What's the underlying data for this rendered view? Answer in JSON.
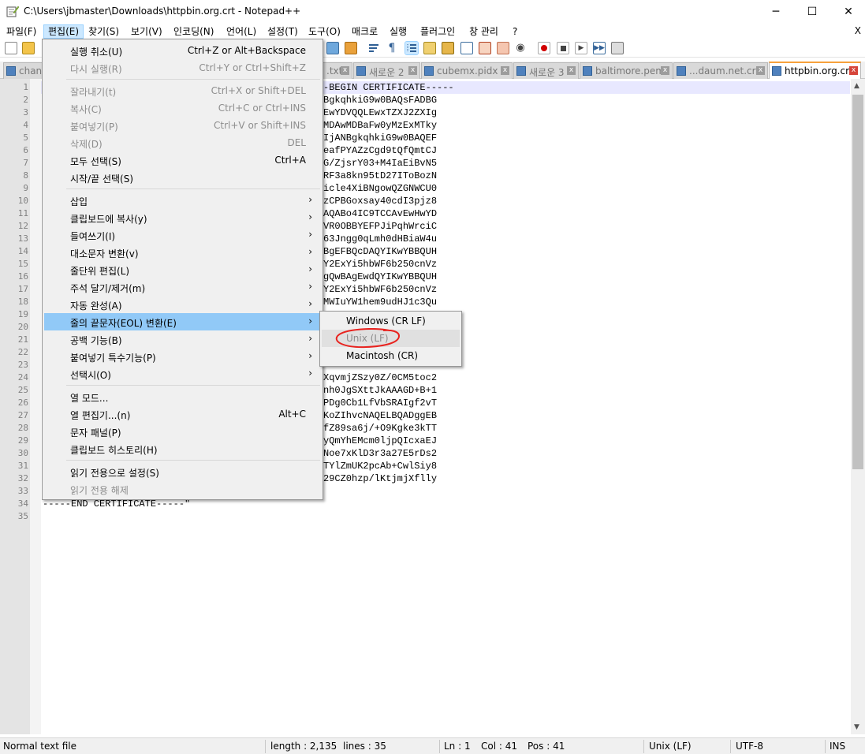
{
  "window": {
    "title": "C:\\Users\\jbmaster\\Downloads\\httpbin.org.crt - Notepad++",
    "minimize": "─",
    "maximize": "☐",
    "close": "✕"
  },
  "menubar": {
    "items": [
      "파일(F)",
      "편집(E)",
      "찾기(S)",
      "보기(V)",
      "인코딩(N)",
      "언어(L)",
      "설정(T)",
      "도구(O)",
      "매크로",
      "실행",
      "플러그인",
      "창 관리",
      "?"
    ],
    "close": "X",
    "active_index": 1
  },
  "tabs": [
    {
      "label": "chan",
      "active": false
    },
    {
      "label": ".txt",
      "active": false
    },
    {
      "label": "새로운 2",
      "active": false
    },
    {
      "label": "cubemx.pidx",
      "active": false
    },
    {
      "label": "새로운 3",
      "active": false
    },
    {
      "label": "baltimore.pem",
      "active": false
    },
    {
      "label": "...daum.net.crt",
      "active": false
    },
    {
      "label": "httpbin.org.crt",
      "active": true
    }
  ],
  "editor": {
    "line_numbers": [
      "1",
      "2",
      "3",
      "4",
      "5",
      "6",
      "7",
      "8",
      "9",
      "10",
      "11",
      "12",
      "13",
      "14",
      "15",
      "16",
      "17",
      "18",
      "19",
      "20",
      "21",
      "22",
      "23",
      "24",
      "25",
      "26",
      "27",
      "28",
      "29",
      "30",
      "31",
      "32",
      "33",
      "34",
      "35"
    ],
    "visible_code": [
      "-BEGIN CERTIFICATE-----",
      "BgkqhkiG9w0BAQsFADBG",
      "EwYDVQQLEwxTZXJ2ZXIg",
      "MDAwMDBaFw0yMzExMTky",
      "IjANBgkqhkiG9w0BAQEF",
      "eafPYAZzCgd9tQfQmtCJ",
      "G/ZjsrY03+M4IaEiBvN5",
      "RF3a8kn95tD27IToBozN",
      "iclе4XiBNgowQZGNWCU0",
      "zCPBGoxsay40cdI3pjz8",
      "AQABo4IC9TCCAvEwHwYD",
      "VR0OBBYEFPJiPqhWrciC",
      "63Jngg0qLmh0dHBiaW4u",
      "BgEFBQcDAQYIKwYBBQUH",
      "Y2ExYi5hbWF6b250cnVz",
      "gQwBAgEwdQYIKwYBBQUH",
      "Y2ExYi5hbWF6b250cnVz",
      "MWIuYW1hem9udHJ1c3Qu",
      "",
      "",
      "",
      "",
      "",
      "XqvmjZSzy0Z/0CM5toc2",
      "nh0JgSXttJkAAAGD+B+1",
      "PDg0Cb1LfVbSRAIgf2vT",
      "KoZIhvcNAQELBQADggEB",
      "fZ89sa6j/+O9Kgke3kTT",
      "yQmYhEMcm0ljpQIcxaEJ",
      "Noe7xKlD3r3a27E5rDs2",
      "TYlZmUK2pcAb+CwlSiy8",
      "29CZ0hzp/lKtjmjXflly",
      "",
      "-----END CERTIFICATE-----\"",
      ""
    ]
  },
  "edit_menu": {
    "items": [
      {
        "label": "실행 취소(U)",
        "shortcut": "Ctrl+Z or Alt+Backspace",
        "disabled": false,
        "submenu": false
      },
      {
        "label": "다시 실행(R)",
        "shortcut": "Ctrl+Y or Ctrl+Shift+Z",
        "disabled": true,
        "submenu": false
      },
      {
        "label": "잘라내기(t)",
        "shortcut": "Ctrl+X or Shift+DEL",
        "disabled": true,
        "submenu": false
      },
      {
        "label": "복사(C)",
        "shortcut": "Ctrl+C or Ctrl+INS",
        "disabled": true,
        "submenu": false
      },
      {
        "label": "붙여넣기(P)",
        "shortcut": "Ctrl+V or Shift+INS",
        "disabled": true,
        "submenu": false
      },
      {
        "label": "삭제(D)",
        "shortcut": "DEL",
        "disabled": true,
        "submenu": false
      },
      {
        "label": "모두 선택(S)",
        "shortcut": "Ctrl+A",
        "disabled": false,
        "submenu": false
      },
      {
        "label": "시작/끝 선택(S)",
        "shortcut": "",
        "disabled": false,
        "submenu": false
      },
      {
        "label": "삽입",
        "shortcut": "",
        "disabled": false,
        "submenu": true
      },
      {
        "label": "클립보드에 복사(y)",
        "shortcut": "",
        "disabled": false,
        "submenu": true
      },
      {
        "label": "들여쓰기(I)",
        "shortcut": "",
        "disabled": false,
        "submenu": true
      },
      {
        "label": "대소문자 변환(v)",
        "shortcut": "",
        "disabled": false,
        "submenu": true
      },
      {
        "label": "줄단위 편집(L)",
        "shortcut": "",
        "disabled": false,
        "submenu": true
      },
      {
        "label": "주석 달기/제거(m)",
        "shortcut": "",
        "disabled": false,
        "submenu": true
      },
      {
        "label": "자동 완성(A)",
        "shortcut": "",
        "disabled": false,
        "submenu": true
      },
      {
        "label": "줄의 끝문자(EOL) 변환(E)",
        "shortcut": "",
        "disabled": false,
        "submenu": true,
        "highlighted": true
      },
      {
        "label": "공백 기능(B)",
        "shortcut": "",
        "disabled": false,
        "submenu": true
      },
      {
        "label": "붙여넣기 특수기능(P)",
        "shortcut": "",
        "disabled": false,
        "submenu": true
      },
      {
        "label": "선택시(O)",
        "shortcut": "",
        "disabled": false,
        "submenu": true
      },
      {
        "label": "열 모드...",
        "shortcut": "",
        "disabled": false,
        "submenu": false
      },
      {
        "label": "열 편집기...(n)",
        "shortcut": "Alt+C",
        "disabled": false,
        "submenu": false
      },
      {
        "label": "문자 패널(P)",
        "shortcut": "",
        "disabled": false,
        "submenu": false
      },
      {
        "label": "클립보드 히스토리(H)",
        "shortcut": "",
        "disabled": false,
        "submenu": false
      },
      {
        "label": "읽기 전용으로 설정(S)",
        "shortcut": "",
        "disabled": false,
        "submenu": false
      },
      {
        "label": "읽기 전용 해제",
        "shortcut": "",
        "disabled": true,
        "submenu": false
      }
    ],
    "submenu_arrow": "›"
  },
  "eol_submenu": {
    "items": [
      {
        "label": "Windows (CR LF)",
        "disabled": false
      },
      {
        "label": "Unix (LF)",
        "disabled": true
      },
      {
        "label": "Macintosh (CR)",
        "disabled": false
      }
    ]
  },
  "statusbar": {
    "file_type": "Normal text file",
    "length": "length : 2,135",
    "lines": "lines : 35",
    "ln": "Ln : 1",
    "col": "Col : 41",
    "pos": "Pos : 41",
    "eol": "Unix (LF)",
    "encoding": "UTF-8",
    "mode": "INS"
  },
  "colors": {
    "menu_highlight": "#91c9f7",
    "annotation_circle": "#e8231f",
    "active_tab_accent": "#f7a13c"
  }
}
